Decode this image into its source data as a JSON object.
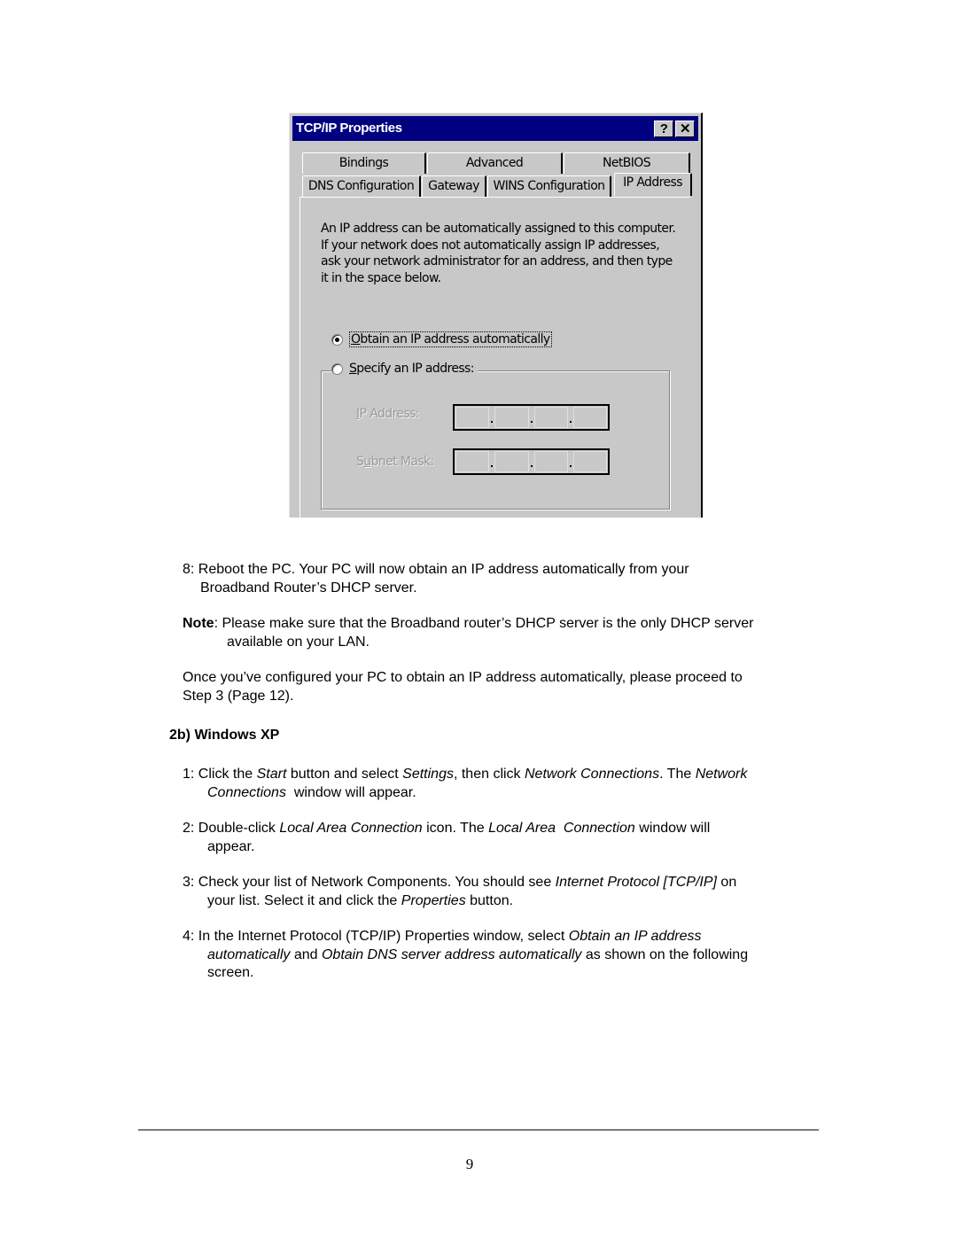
{
  "dialog": {
    "title": "TCP/IP Properties",
    "help_button": "?",
    "close_button": "✕",
    "tabs_row1": [
      "Bindings",
      "Advanced",
      "NetBIOS"
    ],
    "tabs_row2": [
      "DNS Configuration",
      "Gateway",
      "WINS Configuration",
      "IP Address"
    ],
    "active_tab": "IP Address",
    "description": "An IP address can be automatically assigned to this computer. If your network does not automatically assign IP addresses, ask your network administrator for an address, and then type it in the space below.",
    "options": {
      "obtain_auto": {
        "label_accel": "O",
        "label_rest": "btain an IP address automatically",
        "checked": true
      },
      "specify": {
        "label_accel": "S",
        "label_rest": "pecify an IP address:",
        "checked": false
      }
    },
    "fields": {
      "ip_address": {
        "label_accel": "I",
        "label_rest": "P Address:",
        "value": [
          "",
          "",
          "",
          ""
        ],
        "enabled": false
      },
      "subnet_mask": {
        "label_pre": "S",
        "label_accel": "u",
        "label_rest": "bnet Mask:",
        "value": [
          "",
          "",
          "",
          ""
        ],
        "enabled": false
      }
    }
  },
  "document": {
    "step8": {
      "num": "8:",
      "line1": "Reboot the PC. Your PC will now obtain an IP address automatically from your",
      "line2": "Broadband Router’s DHCP server."
    },
    "note": {
      "label": "Note",
      "line1": ": Please make sure that the Broadband router’s DHCP server is the only DHCP server",
      "line2": "available on your LAN."
    },
    "proceed": {
      "line1": "Once you’ve configured your PC to obtain an IP address automatically, please proceed to",
      "line2": "Step 3 (Page 12)."
    },
    "section_heading": "2b) Windows XP",
    "xp_steps": {
      "s1": {
        "num": "1:",
        "a": " Click the ",
        "b": "Start",
        "c": " button and select ",
        "d": "Settings",
        "e": ", then click ",
        "f": "Network Connections",
        "g": ". The ",
        "h": "Network",
        "i": "Connections",
        "j": "  window will appear."
      },
      "s2": {
        "num": "2:",
        "a": " Double-click ",
        "b": "Local Area Connection",
        "c": " icon. The ",
        "d": "Local Area  Connection",
        "e": " window will",
        "f": "appear."
      },
      "s3": {
        "num": "3:",
        "a": " Check your list of Network Components. You should see ",
        "b": "Internet Protocol [TCP/IP]",
        "c": " on",
        "d": "your list. Select it and click the ",
        "e": "Properties",
        "f": " button."
      },
      "s4": {
        "num": "4:",
        "a": " In the Internet Protocol (TCP/IP) Properties window, select ",
        "b": "Obtain an IP address",
        "c": "automatically",
        "d": " and ",
        "e": "Obtain DNS server address automatically",
        "f": " as shown on the following",
        "g": "screen."
      }
    },
    "page_number": "9"
  }
}
